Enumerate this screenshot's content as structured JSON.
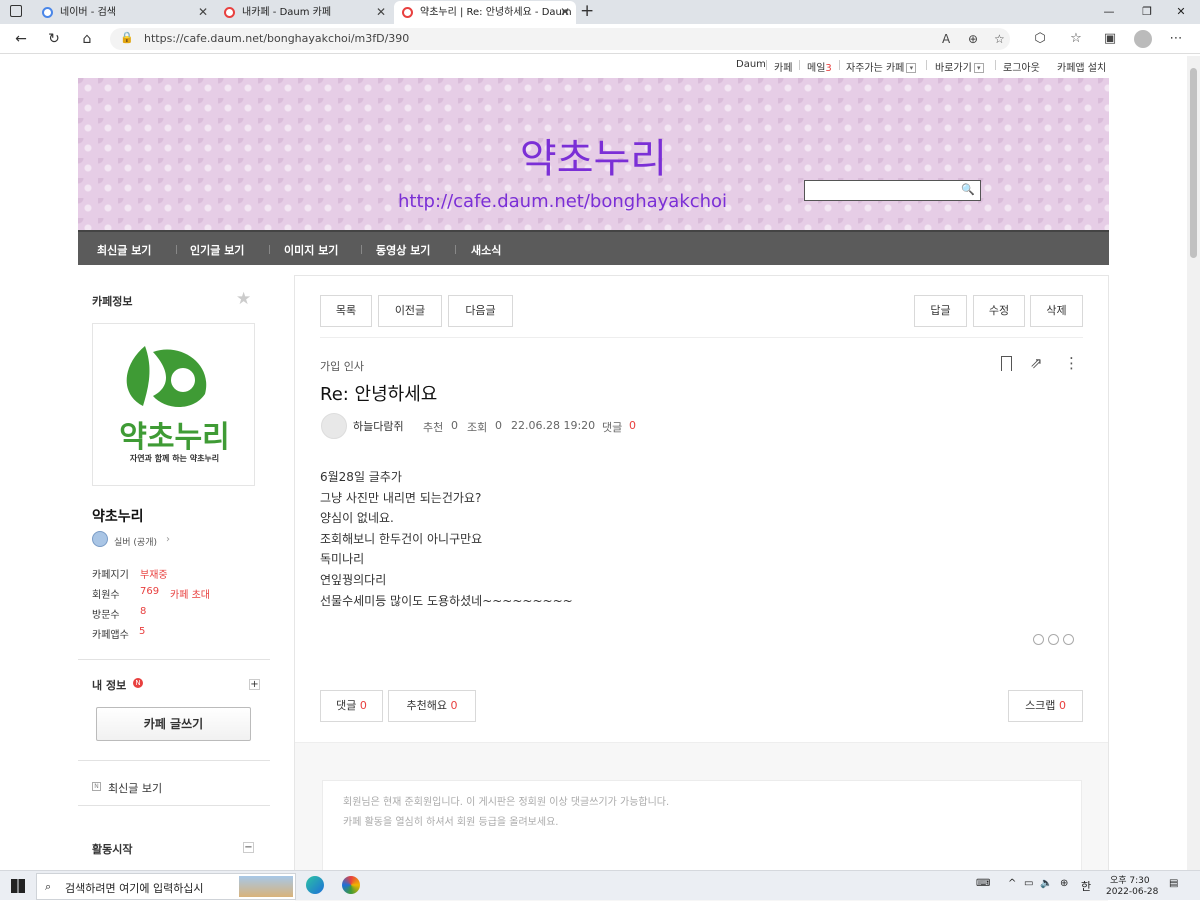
{
  "browser": {
    "tabs": [
      {
        "title": "네이버 - 검색",
        "icon_color": "#03c75a"
      },
      {
        "title": "내카페 - Daum 카페",
        "icon_color": "#e8403f"
      },
      {
        "title": "약초누리 | Re: 안녕하세요 - Daum",
        "icon_color": "#e8403f"
      }
    ],
    "new_tab": "+",
    "window_controls": [
      "—",
      "❐",
      "✕"
    ],
    "url": "https://cafe.daum.net/bonghayakchoi/m3fD/390"
  },
  "gnb": {
    "daum": "Daum",
    "cafe": "카페",
    "mail": "메일",
    "mail_count": "3",
    "favorites": "자주가는 카페",
    "shortcut": "바로가기",
    "logout": "로그아웃",
    "install_app": "카페앱 설치"
  },
  "banner": {
    "title": "약초누리",
    "url": "http://cafe.daum.net/bonghayakchoi"
  },
  "menu": [
    "최신글 보기",
    "인기글 보기",
    "이미지 보기",
    "동영상 보기",
    "새소식"
  ],
  "sidebar": {
    "cafe_info": "카페정보",
    "logo_title": "약초누리",
    "logo_subtitle": "자연과 함께 하는 약초누리",
    "cafe_name": "약초누리",
    "grade": "실버 (공개)",
    "manager_label": "카페지기",
    "manager_value": "부재중",
    "members_label": "회원수",
    "members_value": "769",
    "invite": "카페 초대",
    "visits_label": "방문수",
    "visits_value": "8",
    "app_label": "카페앱수",
    "app_value": "5",
    "my_info": "내 정보",
    "write_button": "카페 글쓰기",
    "latest": "최신글 보기",
    "activity": "활동시작"
  },
  "post": {
    "buttons_left": [
      "목록",
      "이전글",
      "다음글"
    ],
    "buttons_right": [
      "답글",
      "수정",
      "삭제"
    ],
    "category": "가입 인사",
    "title": "Re: 안녕하세요",
    "author": "하늘다람쥐",
    "recommend_label": "추천",
    "recommend_value": "0",
    "views_label": "조회",
    "views_value": "0",
    "date": "22.06.28 19:20",
    "comments_label": "댓글",
    "comments_value": "0",
    "body": [
      "6월28일 글추가",
      "그냥 사진만 내리면 되는건가요?",
      "양심이 없네요.",
      "조회해보니 한두건이 아니구만요",
      "독미나리",
      "연잎꿩의다리",
      "선물수세미등 많이도 도용하셨네~~~~~~~~~"
    ],
    "footer_comment": "댓글",
    "footer_comment_count": "0",
    "footer_recommend": "추천해요",
    "footer_recommend_count": "0",
    "footer_scrap": "스크랩",
    "footer_scrap_count": "0",
    "notice_line1": "회원님은 현재 준회원입니다. 이 게시판은 정회원 이상 댓글쓰기가 가능합니다.",
    "notice_line2": "카페 활동을 열심히 하셔서 회원 등급을 올려보세요."
  },
  "taskbar": {
    "search_placeholder": "검색하려면 여기에 입력하십시",
    "ime": "한",
    "time": "오후 7:30",
    "date": "2022-06-28"
  },
  "colors": {
    "accent_red": "#e8403f",
    "banner_purple": "#7b2fd6",
    "menu_bg": "#5b5b5b"
  }
}
